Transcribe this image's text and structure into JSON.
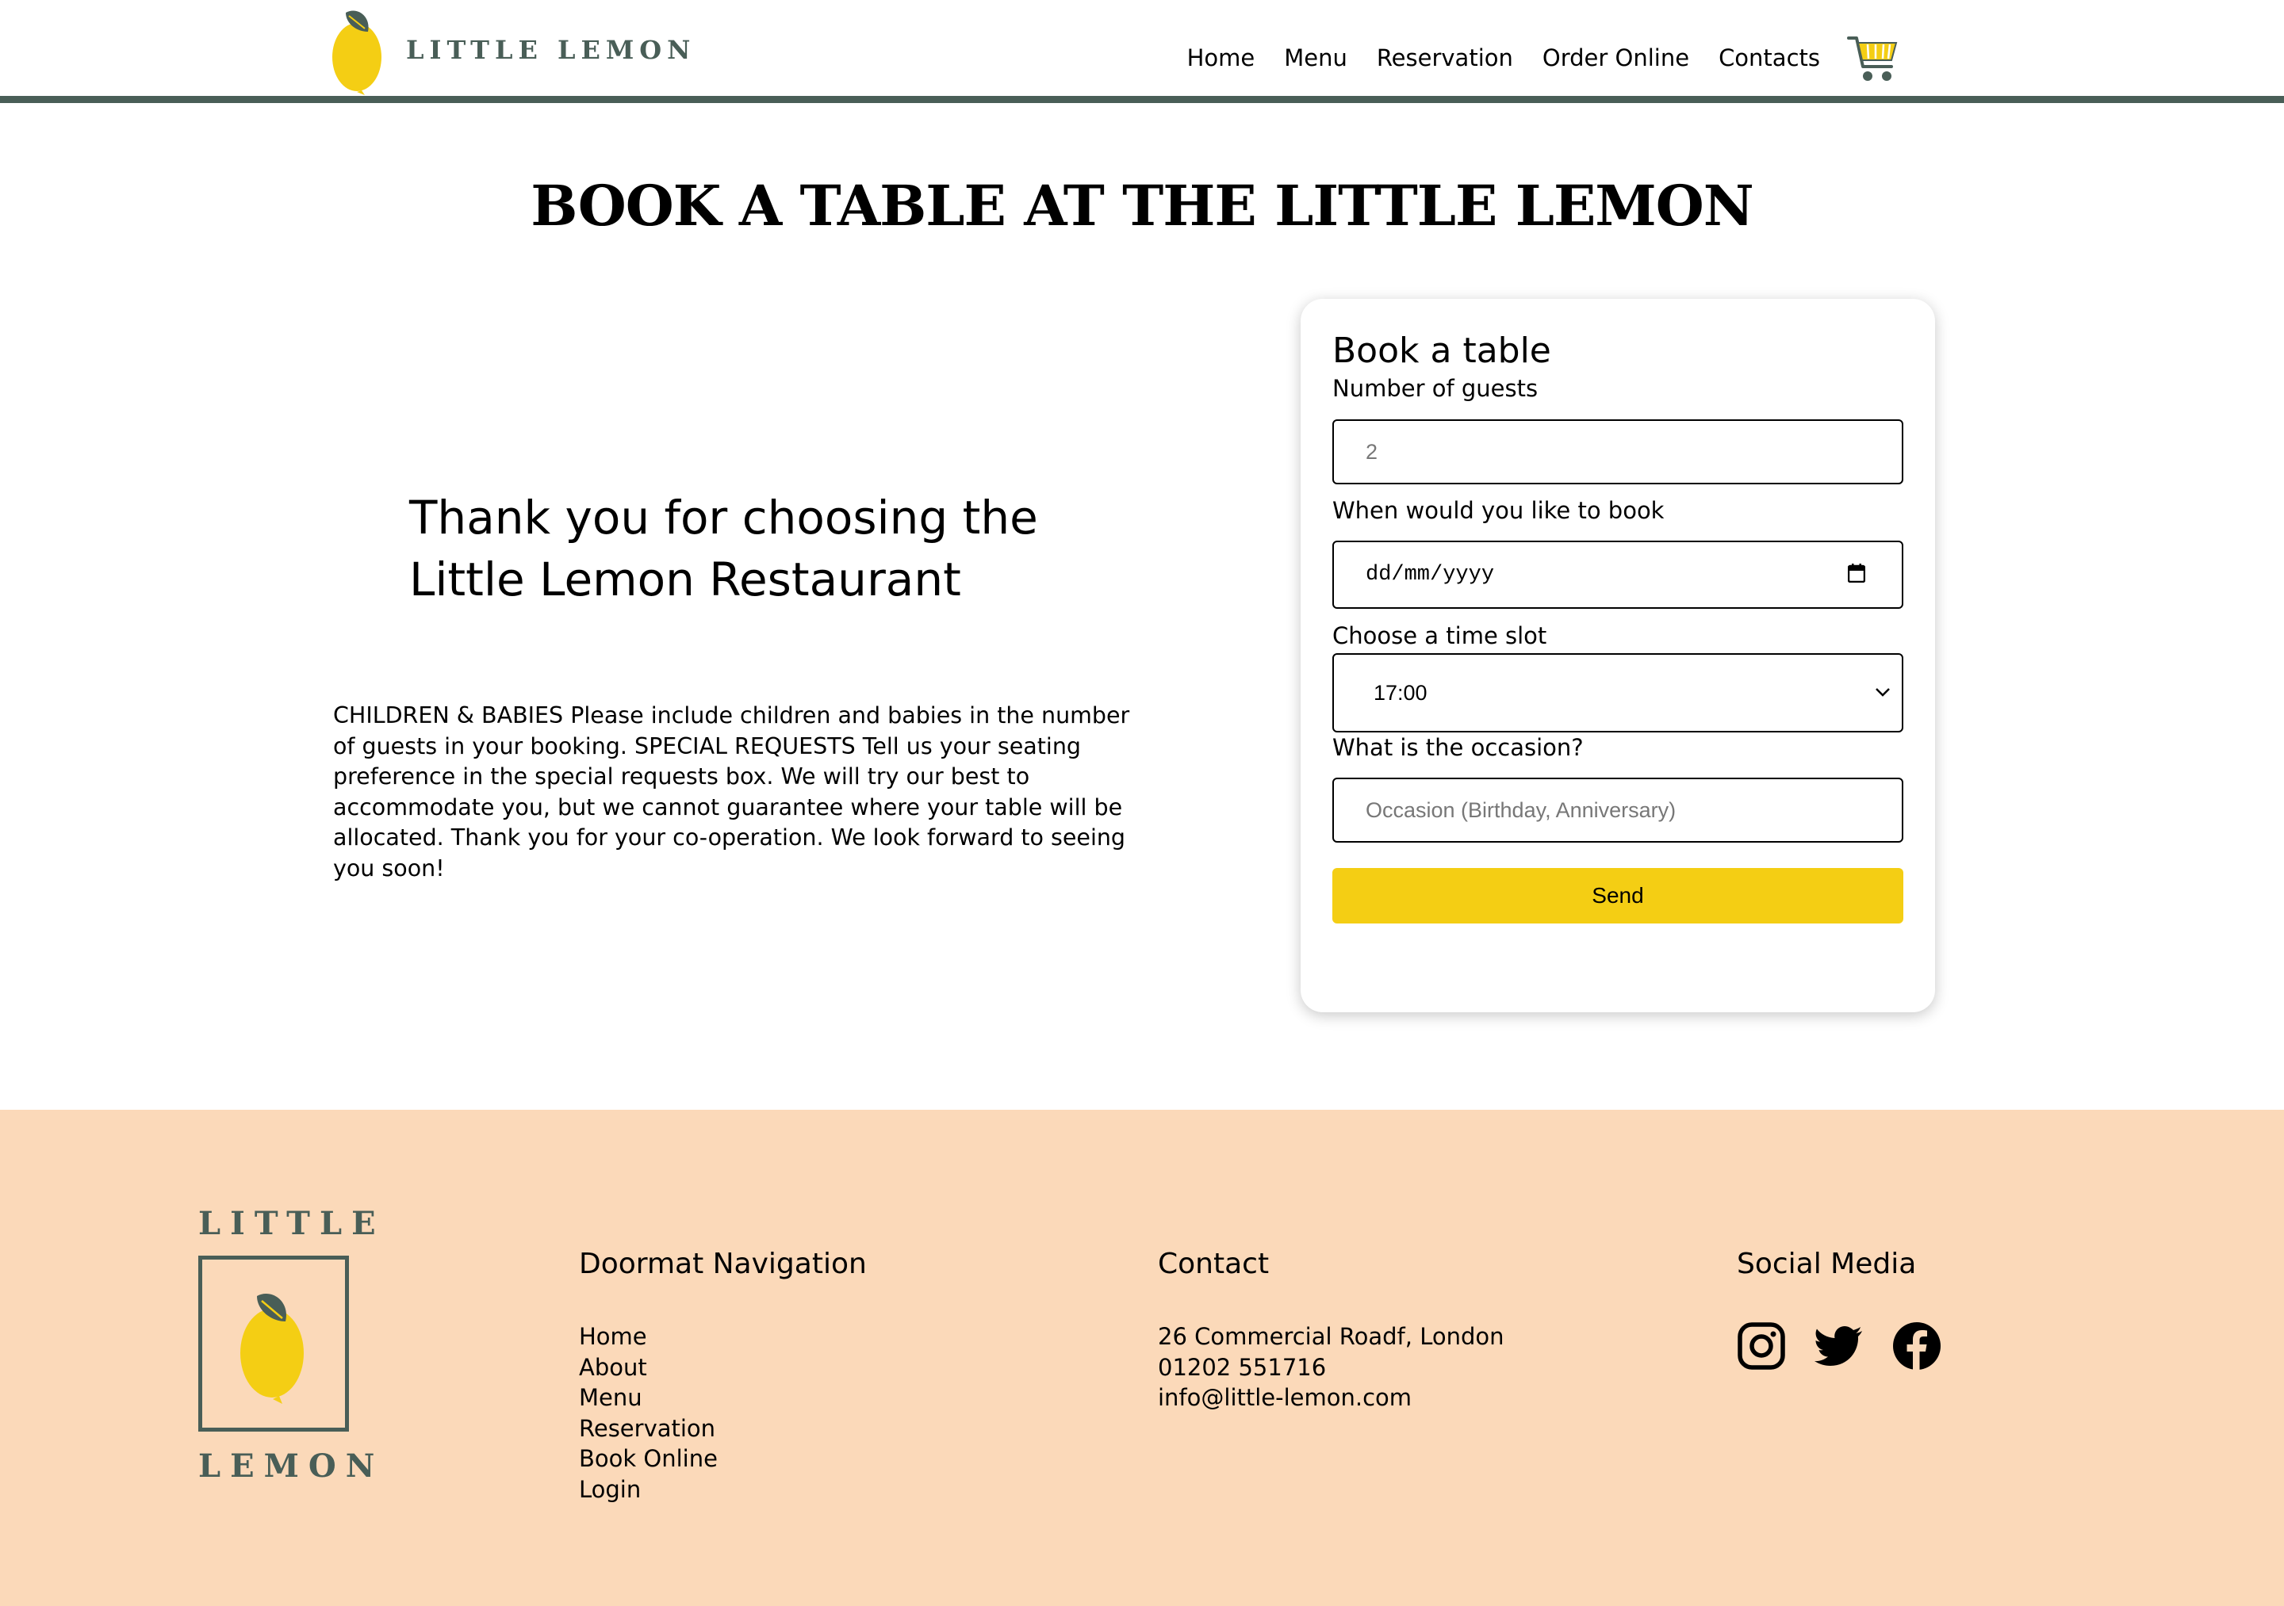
{
  "header": {
    "logo_text": "LITTLE LEMON",
    "nav": [
      "Home",
      "Menu",
      "Reservation",
      "Order Online",
      "Contacts"
    ]
  },
  "page_title": "BOOK A TABLE AT THE LITTLE LEMON",
  "thanks": {
    "line1": "Thank you for choosing the",
    "line2": "Little Lemon Restaurant"
  },
  "notes": "CHILDREN & BABIES Please include children and babies in the number of guests in your booking. SPECIAL REQUESTS Tell us your seating preference in the special requests box. We will try our best to accommodate you, but we cannot guarantee where your table will be allocated. Thank you for your co-operation. We look forward to seeing you soon!",
  "form": {
    "title": "Book a table",
    "guests_label": "Number of guests",
    "guests_placeholder": "2",
    "date_label": "When would you like to book",
    "date_placeholder": "dd/mm/yyyy",
    "time_label": "Choose a time slot",
    "time_value": "17:00",
    "occasion_label": "What is the occasion?",
    "occasion_placeholder": "Occasion (Birthday, Anniversary)",
    "send_label": "Send"
  },
  "footer": {
    "logo_top": "LITTLE",
    "logo_bottom": "LEMON",
    "nav_title": "Doormat Navigation",
    "nav_items": [
      "Home",
      "About",
      "Menu",
      "Reservation",
      "Book Online",
      "Login"
    ],
    "contact_title": "Contact",
    "contact_lines": [
      "26 Commercial Roadf, London",
      "01202 551716",
      "info@little-lemon.com"
    ],
    "social_title": "Social Media",
    "social_icons": [
      "instagram-icon",
      "twitter-icon",
      "facebook-icon"
    ]
  },
  "colors": {
    "brand_green": "#495e57",
    "brand_yellow": "#f4ce14",
    "footer_bg": "#fbd9b9"
  }
}
